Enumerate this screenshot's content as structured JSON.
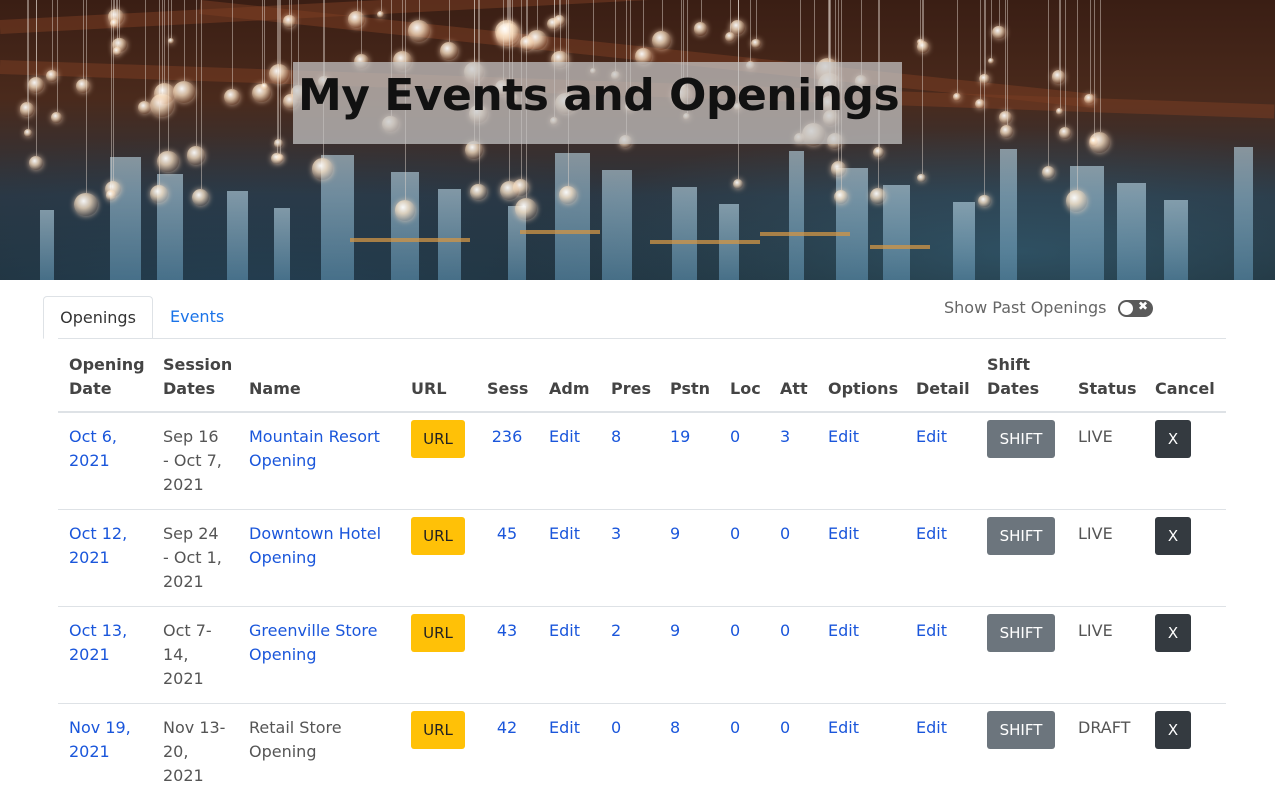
{
  "hero": {
    "title": "My Events and Openings"
  },
  "tabs": [
    {
      "label": "Openings",
      "active": true
    },
    {
      "label": "Events",
      "active": false
    }
  ],
  "toggle": {
    "label": "Show Past Openings",
    "on": false,
    "icon": "close-icon"
  },
  "table": {
    "headers": {
      "opening_date": "Opening Date",
      "session_dates": "Session Dates",
      "name": "Name",
      "url": "URL",
      "sess": "Sess",
      "adm": "Adm",
      "pres": "Pres",
      "pstn": "Pstn",
      "loc": "Loc",
      "att": "Att",
      "options": "Options",
      "detail": "Detail",
      "shift_dates": "Shift Dates",
      "status": "Status",
      "cancel": "Cancel"
    },
    "rows": [
      {
        "opening_date": "Oct 6, 2021",
        "session_dates": "Sep 16 - Oct 7, 2021",
        "name": "Mountain Resort Opening",
        "name_link": true,
        "url_label": "URL",
        "sess": "236",
        "adm": "Edit",
        "pres": "8",
        "pstn": "19",
        "loc": "0",
        "att": "3",
        "options": "Edit",
        "detail": "Edit",
        "shift": "SHIFT",
        "status": "LIVE",
        "cancel": "X"
      },
      {
        "opening_date": "Oct 12, 2021",
        "session_dates": "Sep 24 - Oct 1, 2021",
        "name": "Downtown Hotel Opening",
        "name_link": true,
        "url_label": "URL",
        "sess": "45",
        "adm": "Edit",
        "pres": "3",
        "pstn": "9",
        "loc": "0",
        "att": "0",
        "options": "Edit",
        "detail": "Edit",
        "shift": "SHIFT",
        "status": "LIVE",
        "cancel": "X"
      },
      {
        "opening_date": "Oct 13, 2021",
        "session_dates": "Oct 7-14, 2021",
        "name": "Greenville Store Opening",
        "name_link": true,
        "url_label": "URL",
        "sess": "43",
        "adm": "Edit",
        "pres": "2",
        "pstn": "9",
        "loc": "0",
        "att": "0",
        "options": "Edit",
        "detail": "Edit",
        "shift": "SHIFT",
        "status": "LIVE",
        "cancel": "X"
      },
      {
        "opening_date": "Nov 19, 2021",
        "session_dates": "Nov 13-20, 2021",
        "name": "Retail Store Opening",
        "name_link": false,
        "url_label": "URL",
        "sess": "42",
        "adm": "Edit",
        "pres": "0",
        "pstn": "8",
        "loc": "0",
        "att": "0",
        "options": "Edit",
        "detail": "Edit",
        "shift": "SHIFT",
        "status": "DRAFT",
        "cancel": "X"
      }
    ]
  },
  "colors": {
    "link": "#1a56db",
    "url_button": "#ffc107",
    "shift_button": "#6c757d",
    "cancel_button": "#343a40"
  }
}
